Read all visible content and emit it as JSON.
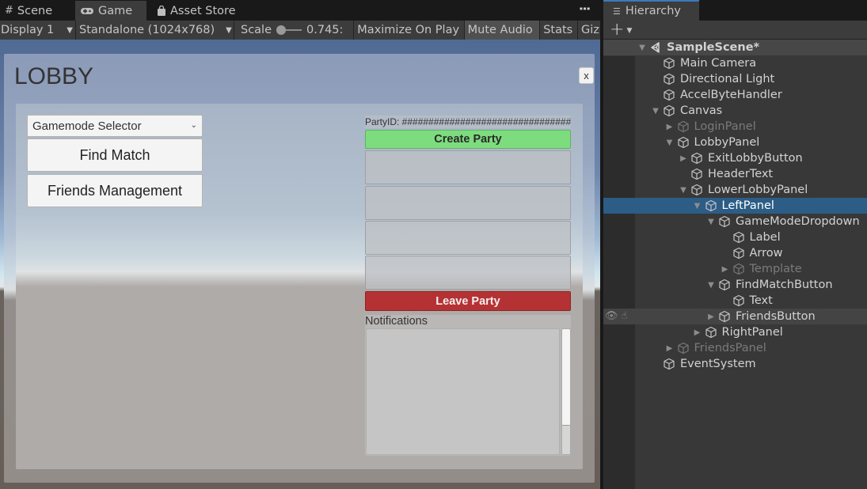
{
  "game_window": {
    "tabs": [
      {
        "label": "Scene",
        "icon": "scene-grid-icon",
        "active": false
      },
      {
        "label": "Game",
        "icon": "gamepad-icon",
        "active": true
      },
      {
        "label": "Asset Store",
        "icon": "shopping-bag-icon",
        "active": false
      }
    ],
    "toolbar": {
      "display": "Display 1",
      "resolution": "Standalone (1024x768)",
      "scale_label": "Scale",
      "scale_value": "0.745:",
      "scale_fraction": 0.0,
      "maximize_on_play": "Maximize On Play",
      "mute_audio": "Mute Audio",
      "mute_audio_active": true,
      "stats": "Stats",
      "gizmos": "Giz"
    }
  },
  "lobby": {
    "title": "LOBBY",
    "close_label": "x",
    "left_panel": {
      "gamemode_dropdown": "Gamemode Selector",
      "find_match": "Find Match",
      "friends_management": "Friends Management"
    },
    "right_panel": {
      "party_id": "PartyID: ################################",
      "create_party": "Create Party",
      "party_slots": [
        "",
        "",
        "",
        ""
      ],
      "leave_party": "Leave Party",
      "notifications_title": "Notifications",
      "notifications": []
    },
    "colors": {
      "create_party": "#7ddc7d",
      "leave_party": "#b43234"
    }
  },
  "hierarchy": {
    "tab_label": "Hierarchy",
    "add_button": "+",
    "selection_color": "#2c5d87",
    "items": [
      {
        "label": "SampleScene*",
        "depth": 0,
        "fold": "open",
        "type": "scene"
      },
      {
        "label": "Main Camera",
        "depth": 1,
        "fold": "none"
      },
      {
        "label": "Directional Light",
        "depth": 1,
        "fold": "none"
      },
      {
        "label": "AccelByteHandler",
        "depth": 1,
        "fold": "none"
      },
      {
        "label": "Canvas",
        "depth": 1,
        "fold": "open"
      },
      {
        "label": "LoginPanel",
        "depth": 2,
        "fold": "closed",
        "inactive": true
      },
      {
        "label": "LobbyPanel",
        "depth": 2,
        "fold": "open"
      },
      {
        "label": "ExitLobbyButton",
        "depth": 3,
        "fold": "closed"
      },
      {
        "label": "HeaderText",
        "depth": 3,
        "fold": "none"
      },
      {
        "label": "LowerLobbyPanel",
        "depth": 3,
        "fold": "open"
      },
      {
        "label": "LeftPanel",
        "depth": 4,
        "fold": "open",
        "selected": true
      },
      {
        "label": "GameModeDropdown",
        "depth": 5,
        "fold": "open"
      },
      {
        "label": "Label",
        "depth": 6,
        "fold": "none"
      },
      {
        "label": "Arrow",
        "depth": 6,
        "fold": "none"
      },
      {
        "label": "Template",
        "depth": 6,
        "fold": "closed",
        "inactive": true
      },
      {
        "label": "FindMatchButton",
        "depth": 5,
        "fold": "open"
      },
      {
        "label": "Text",
        "depth": 6,
        "fold": "none"
      },
      {
        "label": "FriendsButton",
        "depth": 5,
        "fold": "closed",
        "hovered": true
      },
      {
        "label": "RightPanel",
        "depth": 4,
        "fold": "closed"
      },
      {
        "label": "FriendsPanel",
        "depth": 2,
        "fold": "closed",
        "inactive": true
      },
      {
        "label": "EventSystem",
        "depth": 1,
        "fold": "none"
      }
    ]
  }
}
